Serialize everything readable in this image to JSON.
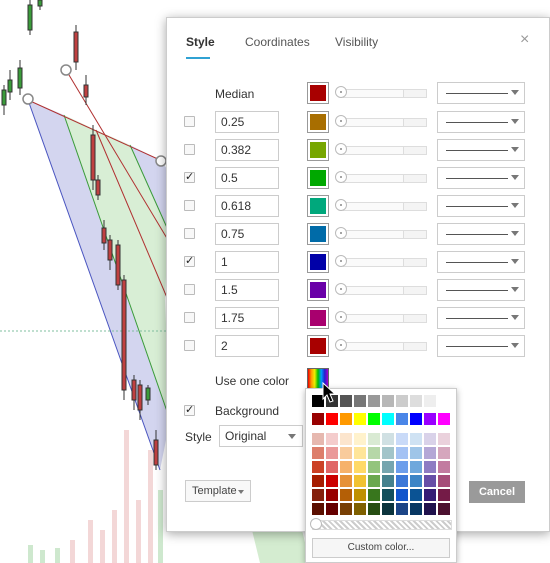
{
  "tabs": [
    {
      "label": "Style",
      "active": true
    },
    {
      "label": "Coordinates",
      "active": false
    },
    {
      "label": "Visibility",
      "active": false
    }
  ],
  "close_label": "×",
  "median": {
    "label": "Median",
    "color": "#a80000"
  },
  "levels": [
    {
      "value": "0.25",
      "checked": false,
      "color": "#a86e00"
    },
    {
      "value": "0.382",
      "checked": false,
      "color": "#77a600"
    },
    {
      "value": "0.5",
      "checked": true,
      "color": "#00a800"
    },
    {
      "value": "0.618",
      "checked": false,
      "color": "#00a87c"
    },
    {
      "value": "0.75",
      "checked": false,
      "color": "#006ba8"
    },
    {
      "value": "1",
      "checked": true,
      "color": "#0000a8"
    },
    {
      "value": "1.5",
      "checked": false,
      "color": "#6a00a8"
    },
    {
      "value": "1.75",
      "checked": false,
      "color": "#a8006e"
    },
    {
      "value": "2",
      "checked": false,
      "color": "#a80000"
    }
  ],
  "use_one_color": {
    "label": "Use one color"
  },
  "background": {
    "label": "Background",
    "checked": true
  },
  "style": {
    "label": "Style",
    "value": "Original"
  },
  "template_label": "Template",
  "cancel_label": "Cancel",
  "palette": {
    "custom_label": "Custom color...",
    "grays": [
      "#000000",
      "#333333",
      "#555555",
      "#777777",
      "#999999",
      "#b7b7b7",
      "#cccccc",
      "#dddddd",
      "#eeeeee",
      "#ffffff"
    ],
    "brights": [
      "#980000",
      "#ff0000",
      "#ff9900",
      "#ffff00",
      "#00ff00",
      "#00ffff",
      "#4a86e8",
      "#0000ff",
      "#9900ff",
      "#ff00ff"
    ],
    "shades": [
      [
        "#e6b8af",
        "#f4cccc",
        "#fce5cd",
        "#fff2cc",
        "#d9ead3",
        "#d0e0e3",
        "#c9daf8",
        "#cfe2f3",
        "#d9d2e9",
        "#ead1dc"
      ],
      [
        "#dd7e6b",
        "#ea9999",
        "#f9cb9c",
        "#ffe599",
        "#b6d7a8",
        "#a2c4c9",
        "#a4c2f4",
        "#9fc5e8",
        "#b4a7d6",
        "#d5a6bd"
      ],
      [
        "#cc4125",
        "#e06666",
        "#f6b26b",
        "#ffd966",
        "#93c47d",
        "#76a5af",
        "#6d9eeb",
        "#6fa8dc",
        "#8e7cc3",
        "#c27ba0"
      ],
      [
        "#a61c00",
        "#cc0000",
        "#e69138",
        "#f1c232",
        "#6aa84f",
        "#45818e",
        "#3c78d8",
        "#3d85c6",
        "#674ea7",
        "#a64d79"
      ],
      [
        "#85200c",
        "#990000",
        "#b45f06",
        "#bf9000",
        "#38761d",
        "#134f5c",
        "#1155cc",
        "#0b5394",
        "#351c75",
        "#741b47"
      ],
      [
        "#5b0f00",
        "#660000",
        "#783f04",
        "#7f6000",
        "#274e13",
        "#0c343d",
        "#1c4587",
        "#073763",
        "#20124d",
        "#4c1130"
      ]
    ]
  }
}
